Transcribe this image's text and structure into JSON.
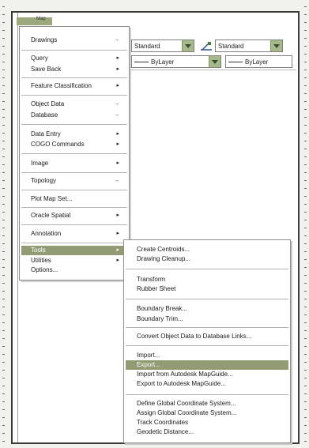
{
  "menubar": {
    "label": "Map"
  },
  "toolbar": {
    "text_style": "Standard",
    "dim_style": "Standard",
    "linetype": "ByLayer",
    "lineweight": "ByLayer"
  },
  "menu": {
    "items": [
      {
        "label": "Drawings",
        "submenu": "→"
      },
      {
        "label": "Query",
        "submenu": "▸"
      },
      {
        "label": "Save Back",
        "submenu": "▸"
      },
      {
        "label": "Feature Classification",
        "submenu": "▸"
      },
      {
        "label": "Object Data",
        "submenu": "→"
      },
      {
        "label": "Database",
        "submenu": "→"
      },
      {
        "label": "Data Entry",
        "submenu": "▸"
      },
      {
        "label": "COGO Commands",
        "submenu": "▸"
      },
      {
        "label": "Image",
        "submenu": "▸"
      },
      {
        "label": "Topology",
        "submenu": "→"
      },
      {
        "label": "Plot Map Set...",
        "submenu": ""
      },
      {
        "label": "Oracle Spatial",
        "submenu": "▸"
      },
      {
        "label": "Annotation",
        "submenu": "▸"
      },
      {
        "label": "Tools",
        "submenu": "▸"
      },
      {
        "label": "Utilities",
        "submenu": "▸"
      },
      {
        "label": "Options...",
        "submenu": ""
      }
    ]
  },
  "tools_submenu": {
    "items": [
      {
        "label": "Create Centroids..."
      },
      {
        "label": "Drawing Cleanup..."
      },
      {
        "label": "Transform"
      },
      {
        "label": "Rubber Sheet"
      },
      {
        "label": "Boundary Break..."
      },
      {
        "label": "Boundary Trim..."
      },
      {
        "label": "Convert Object Data to Database Links..."
      },
      {
        "label": "Import..."
      },
      {
        "label": "Export..."
      },
      {
        "label": "Import from Autodesk MapGuide..."
      },
      {
        "label": "Export to Autodesk MapGuide..."
      },
      {
        "label": "Define Global Coordinate System..."
      },
      {
        "label": "Assign Global Coordinate System..."
      },
      {
        "label": "Track Coordinates"
      },
      {
        "label": "Geodetic Distance..."
      }
    ]
  },
  "colors": {
    "highlight": "#929b74",
    "combo_arrow": "#a6b98a"
  }
}
